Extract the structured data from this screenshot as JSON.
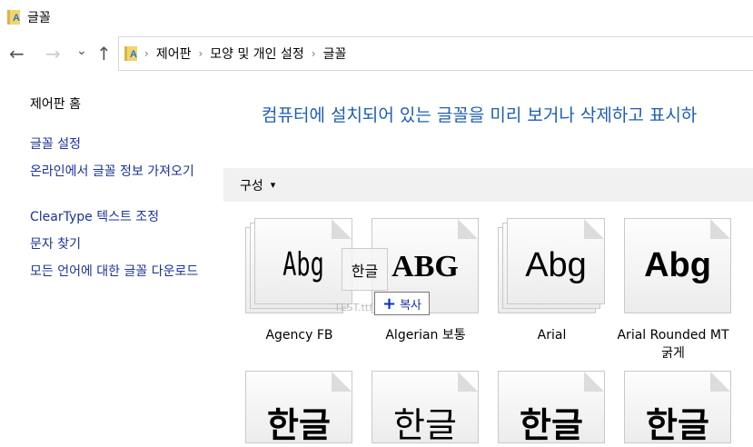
{
  "window": {
    "title": "글꼴",
    "icon": "fonts-folder-icon"
  },
  "nav": {
    "back": "←",
    "forward": "→",
    "recent": "⌄",
    "up": "↑"
  },
  "breadcrumb": [
    "제어판",
    "모양 및 개인 설정",
    "글꼴"
  ],
  "sidebar": {
    "items": [
      "제어판 홈",
      "글꼴 설정",
      "온라인에서 글꼴 정보 가져오기",
      "ClearType 텍스트 조정",
      "문자 찾기",
      "모든 언어에 대한 글꼴 다운로드"
    ]
  },
  "heading": "컴퓨터에 설치되어 있는 글꼴을 미리 보거나 삭제하고 표시하",
  "toolbar": {
    "organize": "구성",
    "arrow": "▾"
  },
  "fonts": [
    {
      "name": "Agency FB",
      "sample": "Abg",
      "stacked": true
    },
    {
      "name": "Algerian 보통",
      "sample": "ABG",
      "stacked": false
    },
    {
      "name": "Arial",
      "sample": "Abg",
      "stacked": true
    },
    {
      "name": "Arial Rounded MT 굵게",
      "sample": "Abg",
      "stacked": false
    }
  ],
  "row2": {
    "sample": "한글"
  },
  "drag": {
    "ghost_sample": "한글",
    "file": "TEST.ttf",
    "tooltip_icon": "+",
    "tooltip": "복사"
  }
}
